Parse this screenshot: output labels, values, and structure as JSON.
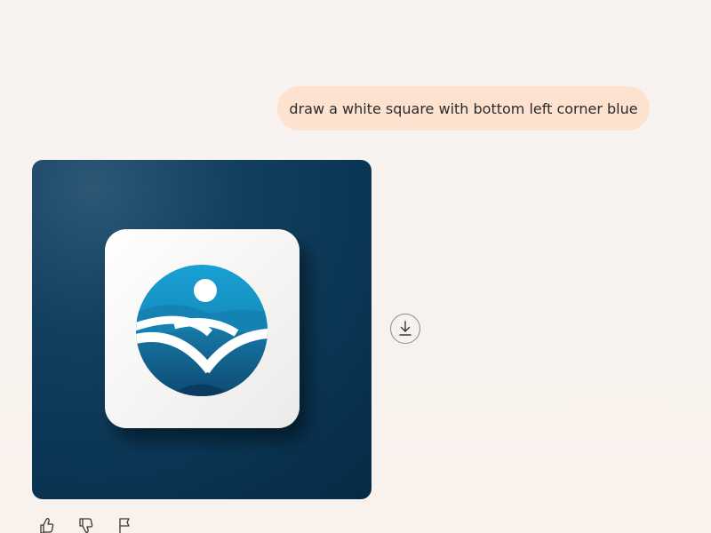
{
  "conversation": {
    "user_message": "draw a white square with bottom left corner blue"
  },
  "response": {
    "image": {
      "description_icon": "landscape-logo-icon",
      "background_color": "#0a3655",
      "tile_color": "#ffffff",
      "accent_color": "#1898d0"
    },
    "actions": {
      "download_icon": "download-icon"
    },
    "feedback": {
      "like_icon": "thumbs-up-icon",
      "dislike_icon": "thumbs-down-icon",
      "report_icon": "flag-icon"
    }
  }
}
